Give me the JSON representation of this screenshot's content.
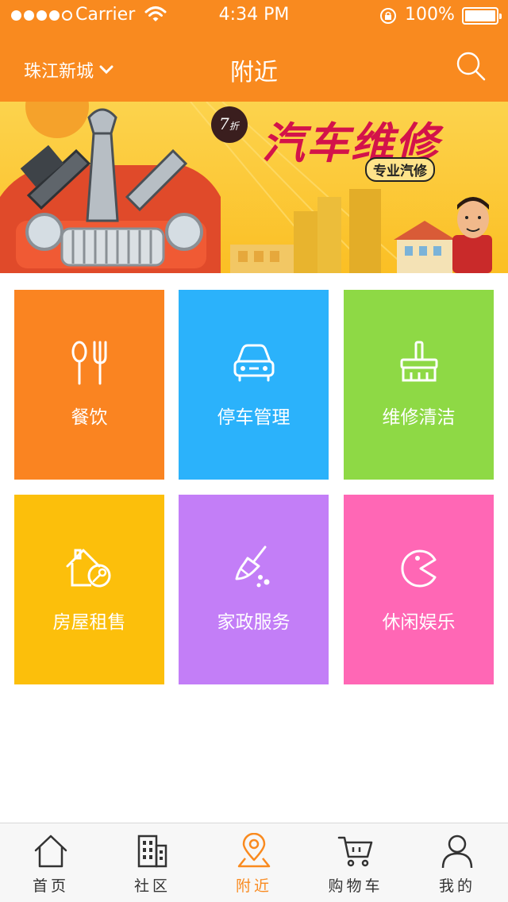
{
  "status_bar": {
    "carrier": "Carrier",
    "time": "4:34 PM",
    "battery": "100%"
  },
  "nav": {
    "city": "珠江新城",
    "title": "附近",
    "search_icon": "search-icon"
  },
  "banner": {
    "headline": "汽车维修",
    "tagline": "专业汽修",
    "discount": "7",
    "discount_unit": "折"
  },
  "categories": [
    {
      "label": "餐饮",
      "icon": "spoon-fork-icon",
      "color": "#FA8421"
    },
    {
      "label": "停车管理",
      "icon": "car-icon",
      "color": "#2BB2FB"
    },
    {
      "label": "维修清洁",
      "icon": "broom-icon",
      "color": "#8ED945"
    },
    {
      "label": "房屋租售",
      "icon": "house-key-icon",
      "color": "#FCBF0B"
    },
    {
      "label": "家政服务",
      "icon": "duster-icon",
      "color": "#C37EF7"
    },
    {
      "label": "休闲娱乐",
      "icon": "pacman-icon",
      "color": "#FF67B5"
    }
  ],
  "tabbar": [
    {
      "label": "首页",
      "icon": "home-icon",
      "active": false
    },
    {
      "label": "社区",
      "icon": "building-icon",
      "active": false
    },
    {
      "label": "附近",
      "icon": "location-pin-icon",
      "active": true
    },
    {
      "label": "购物车",
      "icon": "cart-icon",
      "active": false
    },
    {
      "label": "我的",
      "icon": "user-icon",
      "active": false
    }
  ],
  "colors": {
    "accent": "#F98A1F",
    "tab_inactive": "#333333"
  }
}
